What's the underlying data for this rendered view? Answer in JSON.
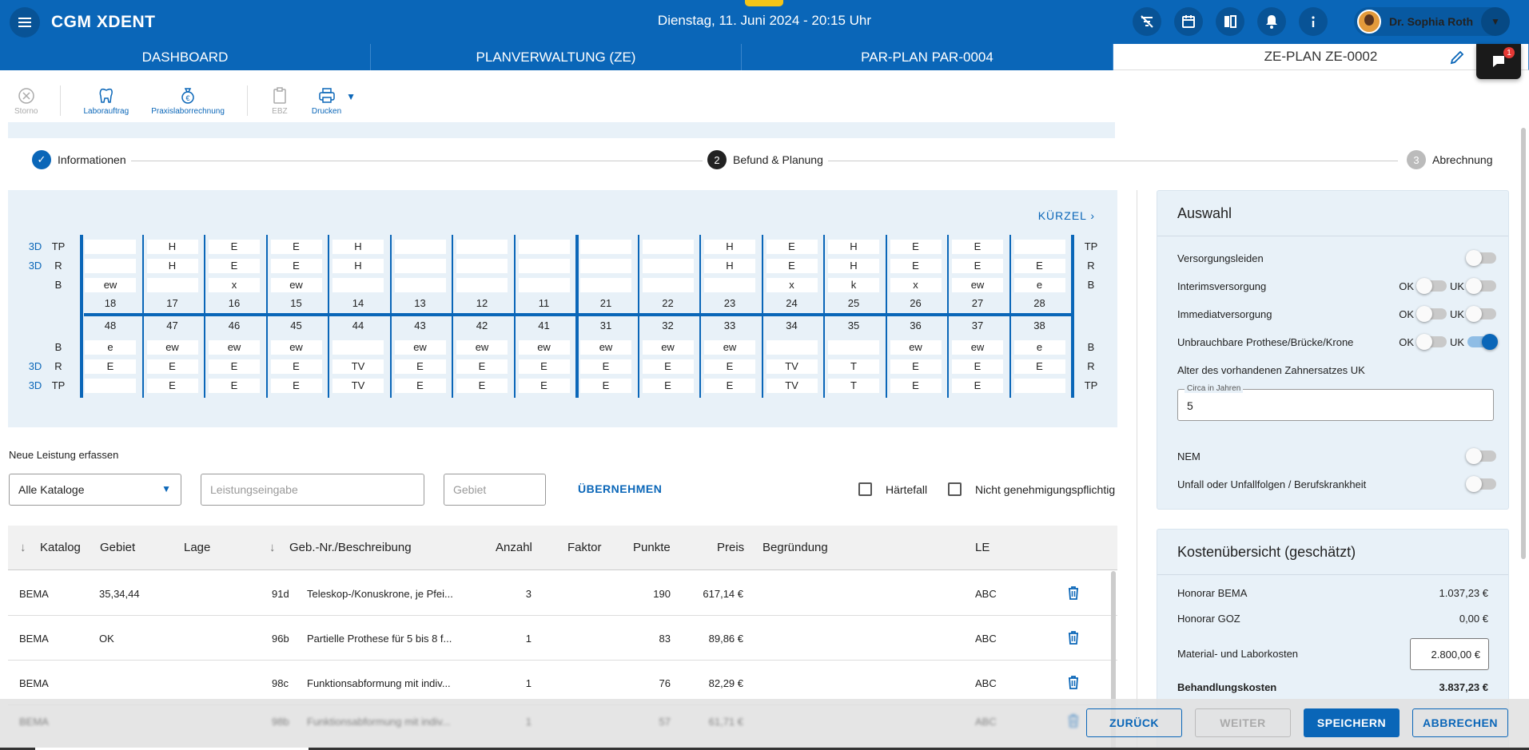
{
  "header": {
    "brand": "CGM XDENT",
    "datetime": "Dienstag, 11. Juni 2024 - 20:15 Uhr",
    "user_name": "Dr. Sophia Roth"
  },
  "nav_tabs": [
    "DASHBOARD",
    "PLANVERWALTUNG (ZE)",
    "PAR-PLAN PAR-0004",
    "ZE-PLAN ZE-0002"
  ],
  "chat_badge": "1",
  "toolbar": {
    "storno": "Storno",
    "laborauftrag": "Laborauftrag",
    "praxislaborrechnung": "Praxislaborrechnung",
    "ebz": "EBZ",
    "drucken": "Drucken"
  },
  "stepper": {
    "step1": "Informationen",
    "step2_num": "2",
    "step2": "Befund & Planung",
    "step3_num": "3",
    "step3": "Abrechnung"
  },
  "dental_chart": {
    "kuerzel": "KÜRZEL",
    "label_3d": "3D",
    "row_labels": {
      "tp": "TP",
      "r": "R",
      "b": "B"
    },
    "upper": {
      "teeth": [
        "18",
        "17",
        "16",
        "15",
        "14",
        "13",
        "12",
        "11",
        "21",
        "22",
        "23",
        "24",
        "25",
        "26",
        "27",
        "28"
      ],
      "tp": [
        "",
        "H",
        "E",
        "E",
        "H",
        "",
        "",
        "",
        "",
        "",
        "H",
        "E",
        "H",
        "E",
        "E",
        ""
      ],
      "r": [
        "",
        "H",
        "E",
        "E",
        "H",
        "",
        "",
        "",
        "",
        "",
        "H",
        "E",
        "H",
        "E",
        "E",
        "E"
      ],
      "b": [
        "ew",
        "",
        "x",
        "ew",
        "",
        "",
        "",
        "",
        "",
        "",
        "",
        "x",
        "k",
        "x",
        "ew",
        "e"
      ]
    },
    "lower": {
      "teeth": [
        "48",
        "47",
        "46",
        "45",
        "44",
        "43",
        "42",
        "41",
        "31",
        "32",
        "33",
        "34",
        "35",
        "36",
        "37",
        "38"
      ],
      "b": [
        "e",
        "ew",
        "ew",
        "ew",
        "",
        "ew",
        "ew",
        "ew",
        "ew",
        "ew",
        "ew",
        "",
        "",
        "ew",
        "ew",
        "e"
      ],
      "r": [
        "E",
        "E",
        "E",
        "E",
        "TV",
        "E",
        "E",
        "E",
        "E",
        "E",
        "E",
        "TV",
        "T",
        "E",
        "E",
        "E"
      ],
      "tp": [
        "",
        "E",
        "E",
        "E",
        "TV",
        "E",
        "E",
        "E",
        "E",
        "E",
        "E",
        "TV",
        "T",
        "E",
        "E",
        ""
      ]
    }
  },
  "neue_leistung": {
    "title": "Neue Leistung erfassen",
    "katalog_value": "Alle Kataloge",
    "leistung_placeholder": "Leistungseingabe",
    "gebiet_placeholder": "Gebiet",
    "uebernehmen": "ÜBERNEHMEN",
    "haertefall": "Härtefall",
    "nicht_genehmigungspflichtig": "Nicht genehmigungspflichtig"
  },
  "table": {
    "headers": {
      "katalog": "Katalog",
      "gebiet": "Gebiet",
      "lage": "Lage",
      "geb": "Geb.-Nr./Beschreibung",
      "anzahl": "Anzahl",
      "faktor": "Faktor",
      "punkte": "Punkte",
      "preis": "Preis",
      "begruendung": "Begründung",
      "le": "LE"
    },
    "rows": [
      {
        "katalog": "BEMA",
        "gebiet": "35,34,44",
        "lage": "",
        "nr": "91d",
        "beschreibung": "Teleskop-/Konuskrone, je Pfei...",
        "anzahl": "3",
        "faktor": "",
        "punkte": "190",
        "preis": "617,14 €",
        "le": "ABC"
      },
      {
        "katalog": "BEMA",
        "gebiet": "OK",
        "lage": "",
        "nr": "96b",
        "beschreibung": "Partielle Prothese für 5 bis 8 f...",
        "anzahl": "1",
        "faktor": "",
        "punkte": "83",
        "preis": "89,86 €",
        "le": "ABC"
      },
      {
        "katalog": "BEMA",
        "gebiet": "",
        "lage": "",
        "nr": "98c",
        "beschreibung": "Funktionsabformung mit indiv...",
        "anzahl": "1",
        "faktor": "",
        "punkte": "76",
        "preis": "82,29 €",
        "le": "ABC"
      },
      {
        "katalog": "BEMA",
        "gebiet": "",
        "lage": "",
        "nr": "98b",
        "beschreibung": "Funktionsabformung mit indiv...",
        "anzahl": "1",
        "faktor": "",
        "punkte": "57",
        "preis": "61,71 €",
        "le": "ABC"
      }
    ]
  },
  "auswahl": {
    "title": "Auswahl",
    "versorgungsleiden": "Versorgungsleiden",
    "interimsversorgung": "Interimsversorgung",
    "immediatversorgung": "Immediatversorgung",
    "unbrauchbare": "Unbrauchbare Prothese/Brücke/Krone",
    "ok": "OK",
    "uk": "UK",
    "alter_label": "Alter des vorhandenen Zahnersatzes UK",
    "circa_legend": "Circa in Jahren",
    "circa_value": "5",
    "nem": "NEM",
    "unfall": "Unfall oder Unfallfolgen / Berufskrankheit"
  },
  "kosten": {
    "title": "Kostenübersicht (geschätzt)",
    "honorar_bema_label": "Honorar BEMA",
    "honorar_bema": "1.037,23 €",
    "honorar_goz_label": "Honorar GOZ",
    "honorar_goz": "0,00 €",
    "material_label": "Material- und Laborkosten",
    "material": "2.800,00 €",
    "behandlung_label": "Behandlungskosten",
    "behandlung": "3.837,23 €"
  },
  "footer": {
    "zurueck": "ZURÜCK",
    "weiter": "WEITER",
    "speichern": "SPEICHERN",
    "abbrechen": "ABBRECHEN"
  },
  "colors": {
    "primary": "#0a66b8",
    "panel": "#e8f1f8"
  }
}
